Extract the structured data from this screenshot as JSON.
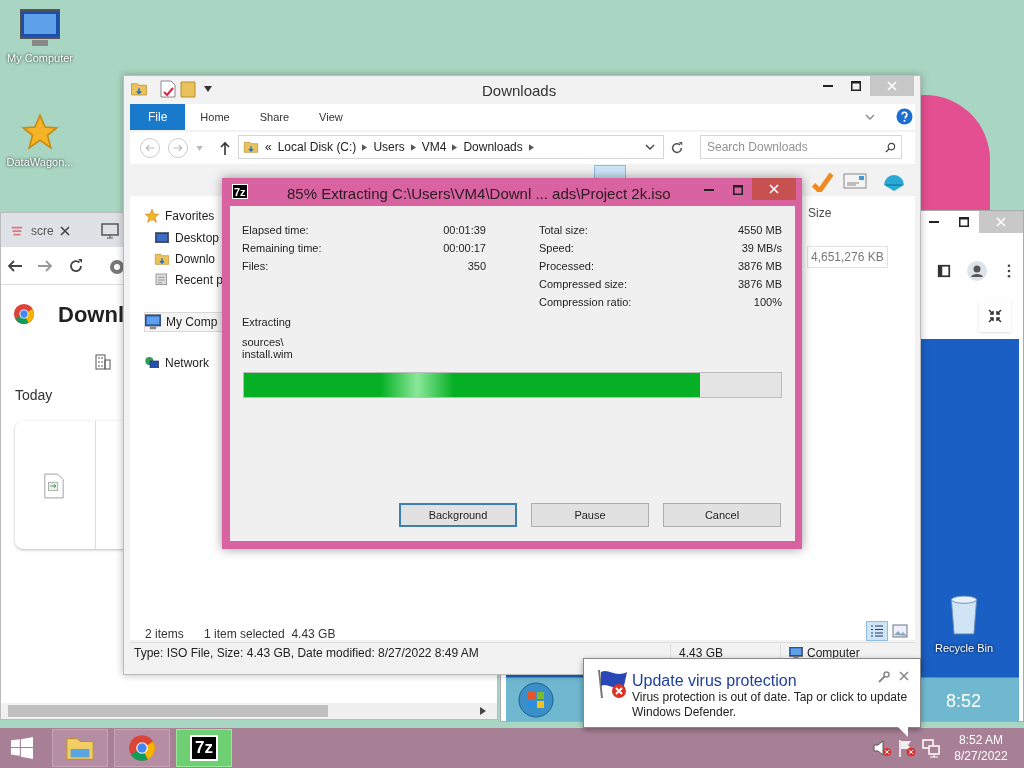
{
  "desktop_icons": [
    {
      "label": "My Computer",
      "kind": "computer"
    },
    {
      "label": "DataWagon...",
      "kind": "star"
    },
    {
      "label": "Recycle Bin",
      "kind": "bin"
    }
  ],
  "browser_window": {
    "tab_title": "scre",
    "page_title": "Downl",
    "section": "Today"
  },
  "vm_window": {
    "clock": "8:52"
  },
  "explorer": {
    "title": "Downloads",
    "ribbon_tabs": [
      {
        "label": "File",
        "selected": true
      },
      {
        "label": "Home",
        "selected": false
      },
      {
        "label": "Share",
        "selected": false
      },
      {
        "label": "View",
        "selected": false
      }
    ],
    "breadcrumb": [
      "«",
      "Local Disk (C:)",
      "Users",
      "VM4",
      "Downloads"
    ],
    "search": {
      "placeholder": "Search Downloads"
    },
    "nav": [
      {
        "label": "Favorites",
        "kind": "star",
        "selected": false
      },
      {
        "label": "Desktop",
        "kind": "desktop",
        "selected": false
      },
      {
        "label": "Downlo",
        "kind": "folder",
        "selected": false
      },
      {
        "label": "Recent p",
        "kind": "recent",
        "selected": false
      },
      {
        "label": "My Comp",
        "kind": "computer",
        "selected": true
      },
      {
        "label": "Network",
        "kind": "network",
        "selected": false
      }
    ],
    "column": "Size",
    "size_cell": "4,651,276 KB",
    "status": {
      "count": "2 items",
      "selection": "1 item selected  4.43 GB"
    },
    "details": "Type: ISO File, Size: 4.43 GB, Date modified: 8/27/2022 8:49 AM",
    "details_size": "4.43 GB",
    "details_location": "Computer"
  },
  "dialog": {
    "icon": "7z",
    "title": "85% Extracting C:\\Users\\VM4\\Downl ... ads\\Project 2k.iso",
    "left_stats": [
      {
        "label": "Elapsed time:",
        "value": "00:01:39"
      },
      {
        "label": "Remaining time:",
        "value": "00:00:17"
      },
      {
        "label": "Files:",
        "value": "350"
      }
    ],
    "right_stats": [
      {
        "label": "Total size:",
        "value": "4550 MB"
      },
      {
        "label": "Speed:",
        "value": "39 MB/s"
      },
      {
        "label": "Processed:",
        "value": "3876 MB"
      },
      {
        "label": "Compressed size:",
        "value": "3876 MB"
      },
      {
        "label": "Compression ratio:",
        "value": "100%"
      }
    ],
    "action": "Extracting",
    "path": "sources\\",
    "file": "install.wim",
    "progress": {
      "level": 0.85
    },
    "buttons": [
      {
        "label": "Background",
        "selected": true
      },
      {
        "label": "Pause",
        "selected": false
      },
      {
        "label": "Cancel",
        "selected": false
      }
    ]
  },
  "notification": {
    "title": "Update virus protection",
    "body": "Virus protection is out of date. Tap or click to update Windows Defender."
  },
  "taskbar": {
    "apps": [
      {
        "kind": "explorer",
        "selected": false
      },
      {
        "kind": "chrome",
        "selected": false
      },
      {
        "kind": "archiver",
        "label": "7z",
        "selected": true
      }
    ],
    "time": "8:52 AM",
    "date": "8/27/2022"
  }
}
